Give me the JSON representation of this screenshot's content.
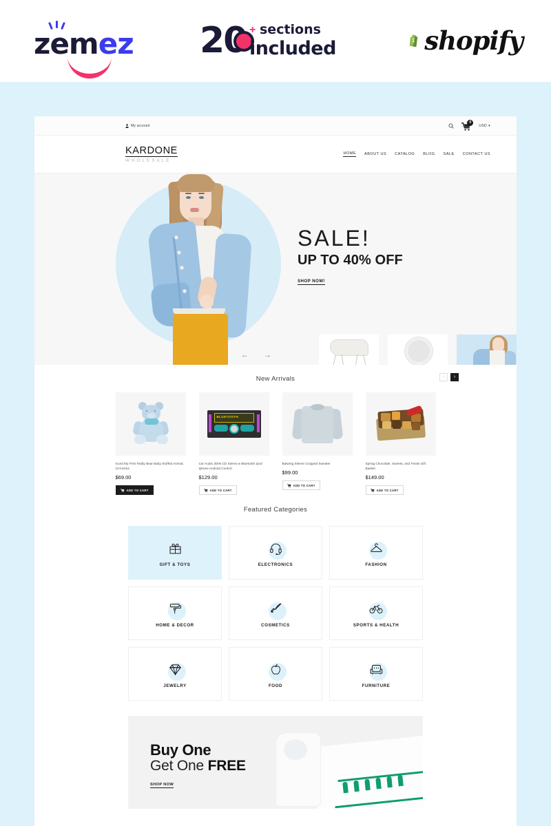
{
  "branding": {
    "zemez_word_part1": "zem",
    "zemez_word_part2": "ez",
    "sections_number": "20",
    "sections_plus": "+",
    "sections_word": "sections",
    "sections_included": "included",
    "shopify_word": "shopify",
    "accent_pink": "#f5316a",
    "accent_blue": "#3b3bf0",
    "shopify_green": "#95bf47",
    "page_background": "#ddf2fa"
  },
  "store": {
    "topbar": {
      "account_label": "My account",
      "search_icon": "search-icon",
      "cart_icon": "cart-icon",
      "cart_count": "0",
      "currency": "USD",
      "currency_caret": "▾"
    },
    "header": {
      "brand_name": "KARDONE",
      "brand_sub": "WHOLESALE",
      "nav": [
        {
          "label": "HOME",
          "active": true
        },
        {
          "label": "ABOUT US",
          "active": false
        },
        {
          "label": "CATALOG",
          "active": false
        },
        {
          "label": "BLOG",
          "active": false
        },
        {
          "label": "SALE",
          "active": false
        },
        {
          "label": "CONTACT US",
          "active": false
        }
      ]
    },
    "hero": {
      "title": "SALE!",
      "subtitle": "UP TO 40% OFF",
      "cta": "SHOP NOW!",
      "prev_arrow": "←",
      "next_arrow": "→",
      "circle_color": "#d6ecf7",
      "thumbs": [
        {
          "name": "chair-thumbnail",
          "active": false
        },
        {
          "name": "speaker-thumbnail",
          "active": false
        },
        {
          "name": "model-thumbnail",
          "active": true
        }
      ]
    },
    "new_arrivals": {
      "title": "New Arrivals",
      "prev_label": "‹",
      "next_label": "›",
      "products": [
        {
          "title": "Gund My First Teddy Bear Baby Stuffed Animal, 10-inches",
          "price": "$69.00",
          "button": "ADD TO CART",
          "button_style": "dark",
          "image": "teddy-bear"
        },
        {
          "title": "Car Audio 2DIN CD Stereo w Bluetooth Ipod Iphone Android Control",
          "price": "$129.00",
          "button": "ADD TO CART",
          "button_style": "light",
          "image": "car-stereo"
        },
        {
          "title": "Batwing Sleeve Cropped Sweater",
          "price": "$99.00",
          "button": "ADD TO CART",
          "button_style": "light",
          "image": "sweater"
        },
        {
          "title": "Spring Chocolate, Sweets, and Treats Gift Basket",
          "price": "$149.00",
          "button": "ADD TO CART",
          "button_style": "light",
          "image": "gift-basket"
        }
      ]
    },
    "featured_categories": {
      "title": "Featured Categories",
      "highlight_color": "#def2fc",
      "items": [
        {
          "label": "GIFT & TOYS",
          "icon": "gift-icon",
          "active": true
        },
        {
          "label": "ELECTRONICS",
          "icon": "headset-icon",
          "active": false
        },
        {
          "label": "FASHION",
          "icon": "hanger-icon",
          "active": false
        },
        {
          "label": "HOME & DECOR",
          "icon": "paint-roller-icon",
          "active": false
        },
        {
          "label": "COSMETICS",
          "icon": "brush-icon",
          "active": false
        },
        {
          "label": "SPORTS & HEALTH",
          "icon": "bicycle-icon",
          "active": false
        },
        {
          "label": "JEWELRY",
          "icon": "diamond-icon",
          "active": false
        },
        {
          "label": "FOOD",
          "icon": "apple-icon",
          "active": false
        },
        {
          "label": "FURNITURE",
          "icon": "armchair-icon",
          "active": false
        }
      ]
    },
    "promo": {
      "line1": "Buy One",
      "line2_light": "Get One ",
      "line2_bold": "FREE",
      "cta": "SHOP NOW"
    }
  }
}
